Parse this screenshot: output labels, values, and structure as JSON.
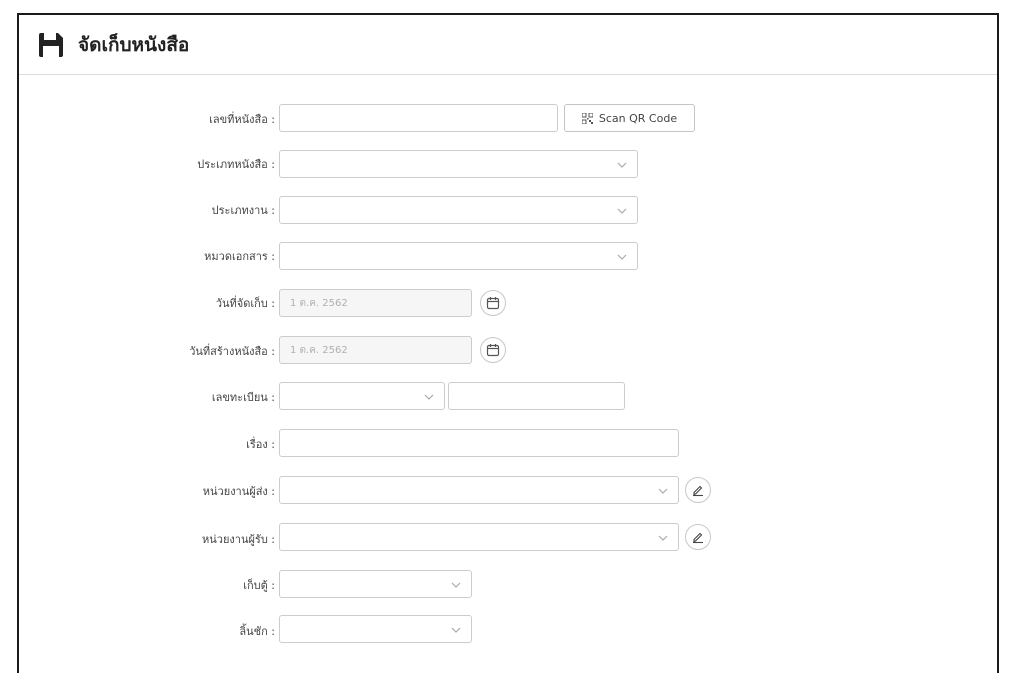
{
  "header": {
    "title": "จัดเก็บหนังสือ",
    "icon": "floppy-disk-icon"
  },
  "form": {
    "book_number": {
      "label": "เลขที่หนังสือ :",
      "value": ""
    },
    "scan_qr": {
      "label": "Scan QR Code",
      "icon": "qr-code-icon"
    },
    "book_type": {
      "label": "ประเภทหนังสือ :",
      "value": ""
    },
    "work_type": {
      "label": "ประเภทงาน :",
      "value": ""
    },
    "doc_category": {
      "label": "หมวดเอกสาร :",
      "value": ""
    },
    "store_date": {
      "label": "วันที่จัดเก็บ :",
      "value": "1 ต.ค. 2562",
      "icon": "calendar-icon"
    },
    "created_date": {
      "label": "วันที่สร้างหนังสือ :",
      "value": "1 ต.ค. 2562",
      "icon": "calendar-icon"
    },
    "registry_number": {
      "label": "เลขทะเบียน :",
      "prefix_value": "",
      "number_value": ""
    },
    "subject": {
      "label": "เรื่อง :",
      "value": ""
    },
    "sender_unit": {
      "label": "หน่วยงานผู้ส่ง :",
      "value": "",
      "icon": "pencil-icon"
    },
    "receiver_unit": {
      "label": "หน่วยงานผู้รับ :",
      "value": "",
      "icon": "pencil-icon"
    },
    "cabinet": {
      "label": "เก็บตู้ :",
      "value": ""
    },
    "drawer": {
      "label": "ลิ้นชัก :",
      "value": ""
    }
  },
  "colors": {
    "frame": "#1a1a1a",
    "input_border": "#cccccc",
    "placeholder": "#b0b0b0",
    "disabled_bg": "#f6f6f6"
  }
}
